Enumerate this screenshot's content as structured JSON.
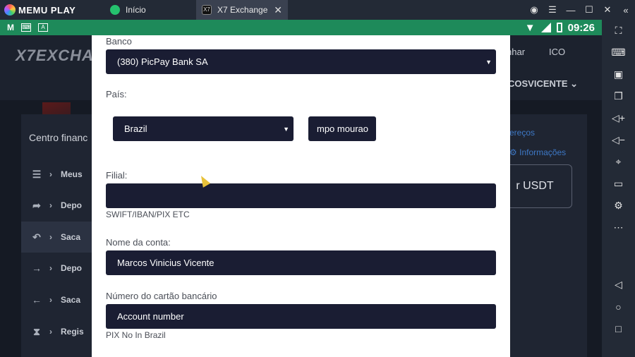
{
  "titlebar": {
    "brand": "MEMU PLAY",
    "tabs": [
      {
        "label": "Início"
      },
      {
        "label": "X7 Exchange",
        "close": "✕"
      }
    ]
  },
  "statusbar": {
    "time": "09:26"
  },
  "background": {
    "logo": "X7EXCHA",
    "nav_1": "nhar",
    "nav_2": "ICO",
    "user": "COSVICENTE",
    "centro": "Centro financ",
    "menu": [
      {
        "label": "Meus"
      },
      {
        "label": "Depo"
      },
      {
        "label": "Saca"
      },
      {
        "label": "Depo"
      },
      {
        "label": "Saca"
      },
      {
        "label": "Regis"
      }
    ],
    "link_1": "ereços",
    "link_2": "Informações",
    "usdt_button": "r USDT"
  },
  "form": {
    "banco_label": "Banco",
    "banco_value": "(380) PicPay Bank SA",
    "pais_label": "País:",
    "pais_value": "Brazil",
    "city_value": "mpo mourao",
    "filial_label": "Filial:",
    "filial_value": "",
    "filial_hint": "SWIFT/IBAN/PIX ETC",
    "nome_label": "Nome da conta:",
    "nome_value": "Marcos Vinicius Vicente",
    "numero_label": "Número do cartão bancário",
    "numero_value": "Account number",
    "numero_hint": "PIX No In Brazil"
  }
}
